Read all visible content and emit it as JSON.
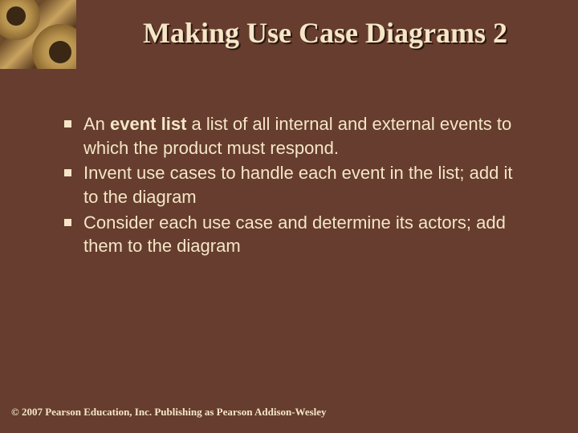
{
  "title": "Making Use Case Diagrams 2",
  "bullets": [
    {
      "prefix": "An ",
      "bold": "event list",
      "rest": " a list of all internal and external events to which the product must respond."
    },
    {
      "prefix": "",
      "bold": "",
      "rest": "Invent use cases to handle each event in the list; add it to the diagram"
    },
    {
      "prefix": "",
      "bold": "",
      "rest": "Consider each use case and determine its actors; add them to the diagram"
    }
  ],
  "footer": "© 2007 Pearson Education, Inc. Publishing as Pearson Addison-Wesley",
  "colors": {
    "background": "#663d2e",
    "text": "#f5e6c8",
    "shadow": "#2a1810"
  }
}
